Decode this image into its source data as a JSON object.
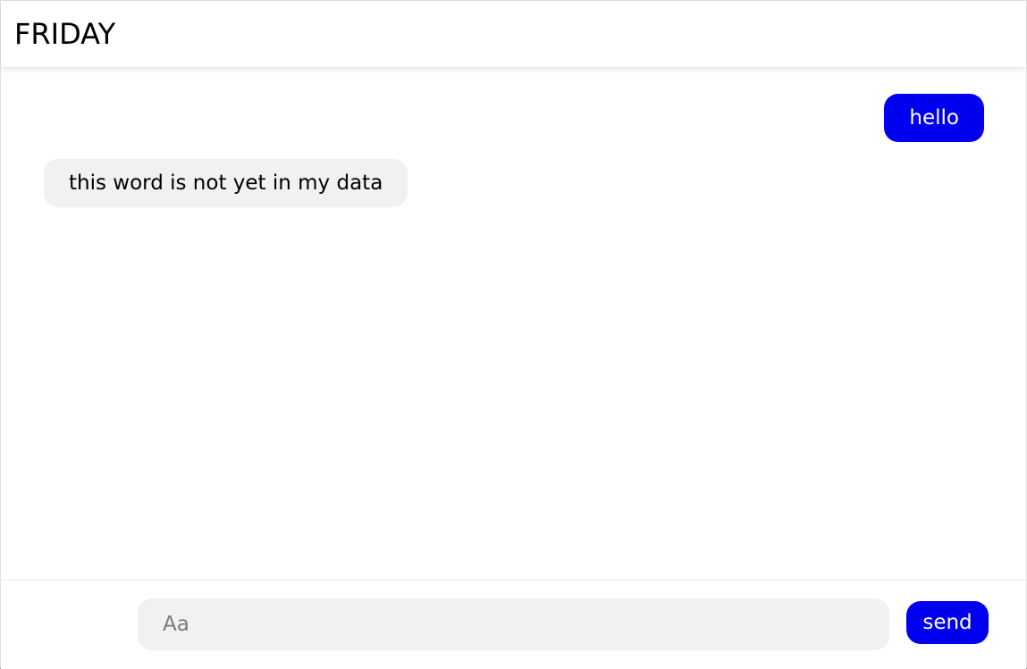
{
  "header": {
    "title": "FRIDAY"
  },
  "messages": [
    {
      "role": "user",
      "text": "hello"
    },
    {
      "role": "bot",
      "text": "this word is not yet in my data"
    }
  ],
  "composer": {
    "placeholder": "Aa",
    "value": "",
    "send_label": "send"
  },
  "colors": {
    "accent": "#0000ee",
    "bot_bubble": "#f1f1f1",
    "input_bg": "#f1f1f1"
  }
}
